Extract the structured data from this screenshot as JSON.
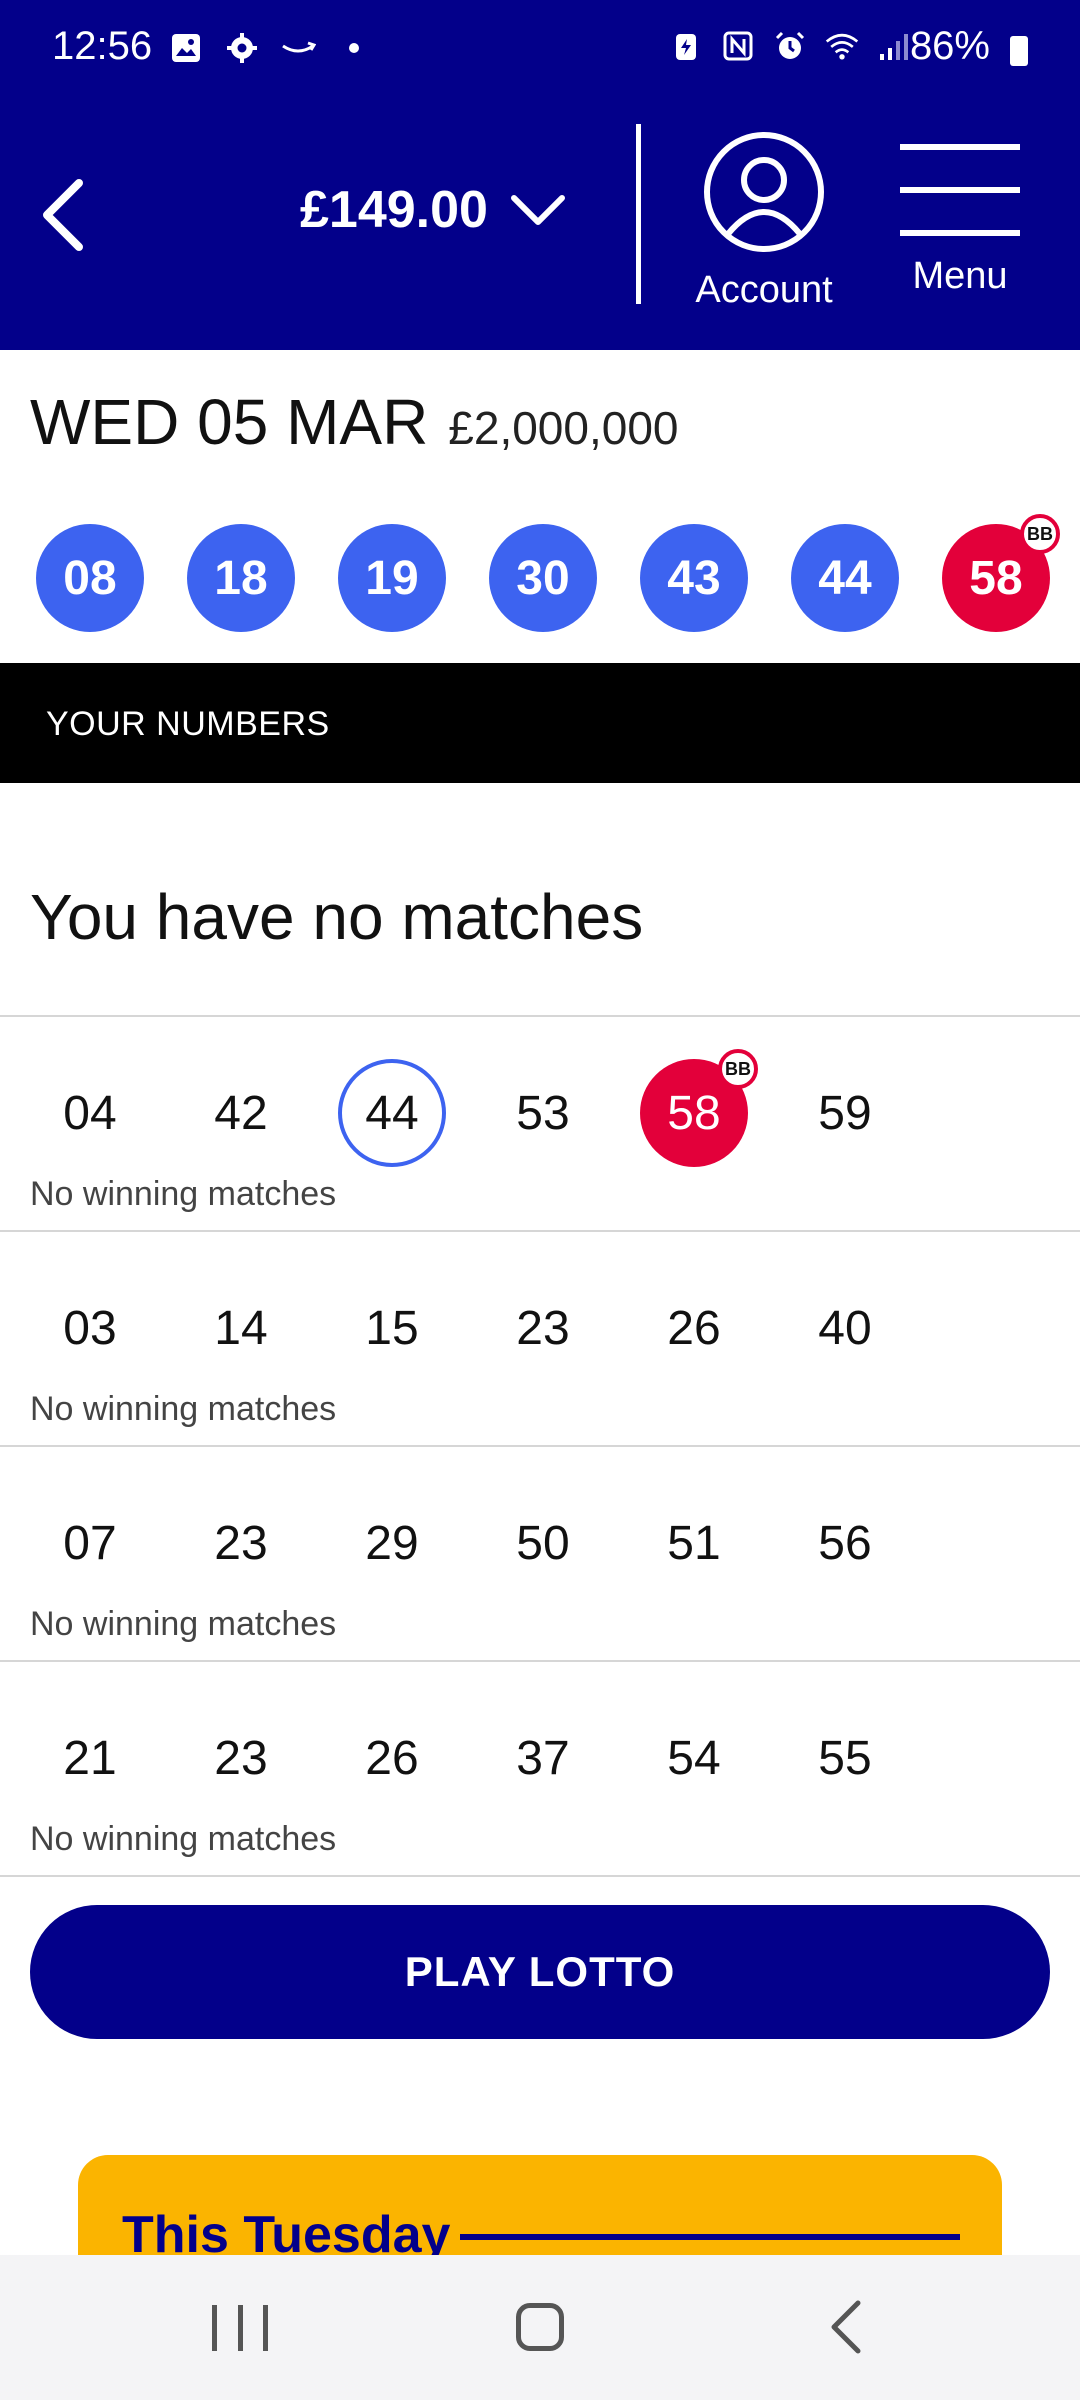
{
  "status_bar": {
    "time": "12:56",
    "battery": "86%"
  },
  "header": {
    "balance": "£149.00",
    "account_label": "Account",
    "menu_label": "Menu"
  },
  "draw": {
    "date": "WED 05 MAR",
    "jackpot": "£2,000,000",
    "balls": [
      "08",
      "18",
      "19",
      "30",
      "43",
      "44"
    ],
    "bonus_ball": "58",
    "bonus_badge": "BB"
  },
  "section_title": "YOUR NUMBERS",
  "result_title": "You have no matches",
  "lines": [
    {
      "numbers": [
        "04",
        "42",
        "44",
        "53",
        "58",
        "59"
      ],
      "status": "No winning matches"
    },
    {
      "numbers": [
        "03",
        "14",
        "15",
        "23",
        "26",
        "40"
      ],
      "status": "No winning matches"
    },
    {
      "numbers": [
        "07",
        "23",
        "29",
        "50",
        "51",
        "56"
      ],
      "status": "No winning matches"
    },
    {
      "numbers": [
        "21",
        "23",
        "26",
        "37",
        "54",
        "55"
      ],
      "status": "No winning matches"
    }
  ],
  "line_badge": "BB",
  "play_button": "PLAY LOTTO",
  "promo": {
    "title": "This Tuesday"
  },
  "colors": {
    "brand_navy": "#03008a",
    "ball_blue": "#3d63f0",
    "bonus_red": "#e3003a",
    "promo_yellow": "#fbb400"
  }
}
